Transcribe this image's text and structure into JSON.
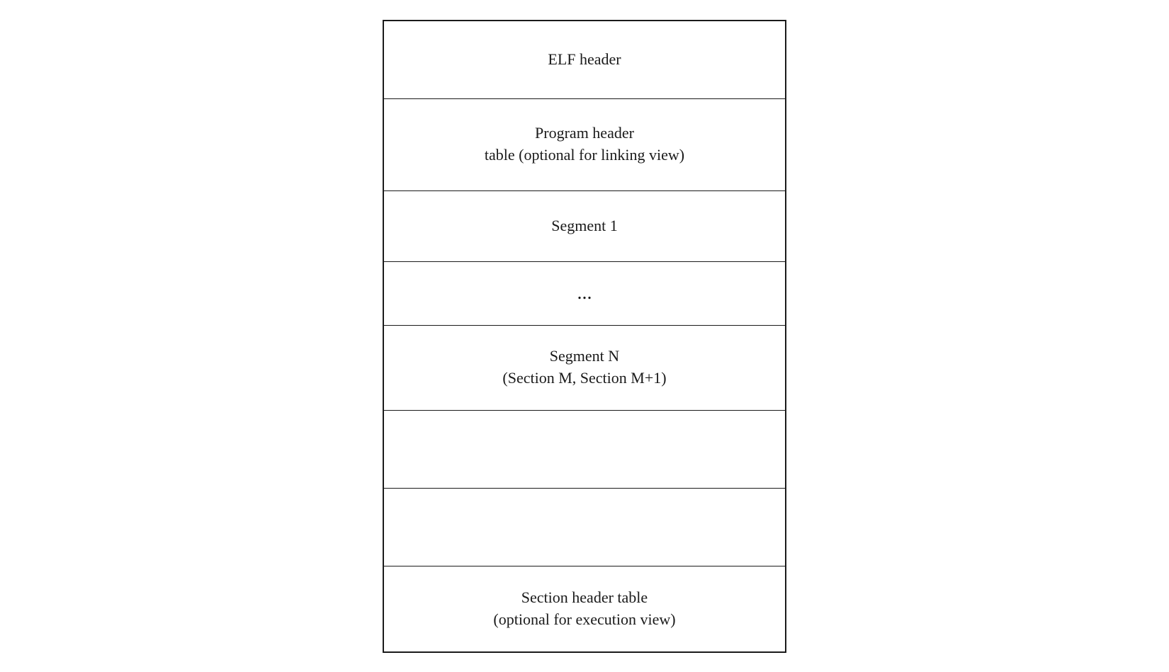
{
  "diagram": {
    "rows": [
      {
        "id": "elf-header",
        "label": "ELF header",
        "class": "row-elf-header"
      },
      {
        "id": "program-header",
        "label": "Program header\ntable (optional for linking view)",
        "class": "row-program-header"
      },
      {
        "id": "segment1",
        "label": "Segment 1",
        "class": "row-segment1"
      },
      {
        "id": "ellipsis",
        "label": "...",
        "class": "row-ellipsis"
      },
      {
        "id": "segment-n",
        "label": "Segment N\n(Section M, Section M+1)",
        "class": "row-segment-n"
      },
      {
        "id": "empty1",
        "label": "",
        "class": "row-empty1"
      },
      {
        "id": "empty2",
        "label": "",
        "class": "row-empty2"
      },
      {
        "id": "section-header",
        "label": "Section header table\n(optional for execution view)",
        "class": "row-section-header"
      }
    ]
  }
}
